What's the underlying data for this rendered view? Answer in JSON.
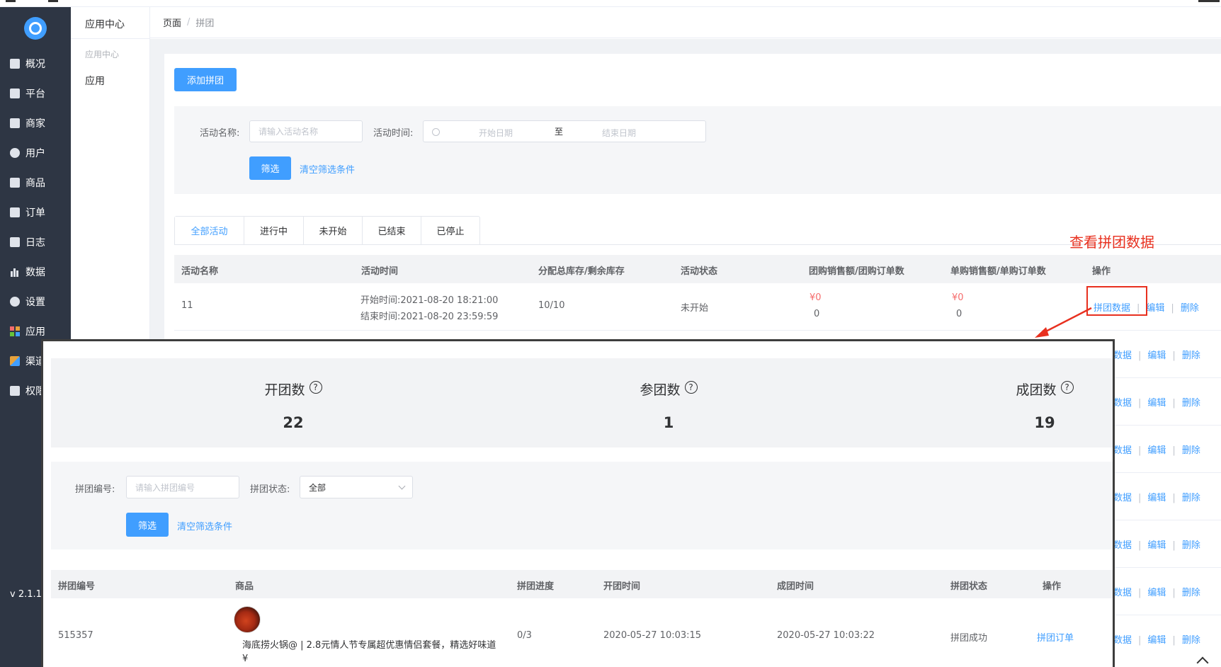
{
  "sidebar": {
    "items": [
      {
        "label": "概况",
        "icon": "overview-icon"
      },
      {
        "label": "平台",
        "icon": "monitor-icon"
      },
      {
        "label": "商家",
        "icon": "store-icon"
      },
      {
        "label": "用户",
        "icon": "user-icon"
      },
      {
        "label": "商品",
        "icon": "goods-icon"
      },
      {
        "label": "订单",
        "icon": "order-icon"
      },
      {
        "label": "日志",
        "icon": "log-icon"
      },
      {
        "label": "数据",
        "icon": "chart-bars-icon"
      },
      {
        "label": "设置",
        "icon": "gear-icon"
      },
      {
        "label": "应用",
        "icon": "apps-grid-icon"
      },
      {
        "label": "渠道",
        "icon": "channel-cube-icon"
      },
      {
        "label": "权限",
        "icon": "lock-icon"
      }
    ],
    "version": "v 2.1.1"
  },
  "subsidebar": {
    "title": "应用中心",
    "group": "应用中心",
    "item": "应用"
  },
  "breadcrumb": {
    "items": [
      "页面",
      "拼团"
    ],
    "separator": "/"
  },
  "toolbar": {
    "add_label": "添加拼团"
  },
  "filter": {
    "name_label": "活动名称:",
    "name_placeholder": "请输入活动名称",
    "time_label": "活动时间:",
    "start_placeholder": "开始日期",
    "range_sep": "至",
    "end_placeholder": "结束日期",
    "submit_label": "筛选",
    "clear_label": "清空筛选条件"
  },
  "tabs": [
    "全部活动",
    "进行中",
    "未开始",
    "已结束",
    "已停止"
  ],
  "table": {
    "headers": [
      "活动名称",
      "活动时间",
      "分配总库存/剩余库存",
      "活动状态",
      "团购销售额/团购订单数",
      "单购销售额/单购订单数",
      "操作"
    ],
    "rows": [
      {
        "name": "11",
        "start": "开始时间:2021-08-20 18:21:00",
        "end": "结束时间:2021-08-20 23:59:59",
        "stock": "10/10",
        "status": "未开始",
        "group_amount": "¥0",
        "group_orders": "0",
        "single_amount": "¥0",
        "single_orders": "0"
      }
    ],
    "ops": {
      "data": "拼团数据",
      "data_partial": "数据",
      "edit": "编辑",
      "delete": "删除"
    }
  },
  "annotation": {
    "text": "查看拼团数据",
    "color": "#e8301f"
  },
  "popup": {
    "stats": [
      {
        "label": "开团数",
        "value": "22"
      },
      {
        "label": "参团数",
        "value": "1"
      },
      {
        "label": "成团数",
        "value": "19"
      }
    ],
    "help_glyph": "?",
    "filter": {
      "no_label": "拼团编号:",
      "no_placeholder": "请输入拼团编号",
      "status_label": "拼团状态:",
      "status_value": "全部",
      "submit_label": "筛选",
      "clear_label": "清空筛选条件"
    },
    "table": {
      "headers": [
        "拼团编号",
        "商品",
        "拼团进度",
        "开团时间",
        "成团时间",
        "拼团状态",
        "操作"
      ],
      "rows": [
        {
          "no": "515357",
          "product": "海底捞火锅@ | 2.8元情人节专属超优惠情侣套餐，精选好味道",
          "price": "¥",
          "progress": "0/3",
          "open_time": "2020-05-27 10:03:15",
          "success_time": "2020-05-27 10:03:22",
          "status": "拼团成功",
          "action": "拼团订单"
        }
      ]
    }
  },
  "colors": {
    "primary": "#409eff",
    "sidebar_bg": "#2e3644",
    "danger": "#f56c6c"
  }
}
